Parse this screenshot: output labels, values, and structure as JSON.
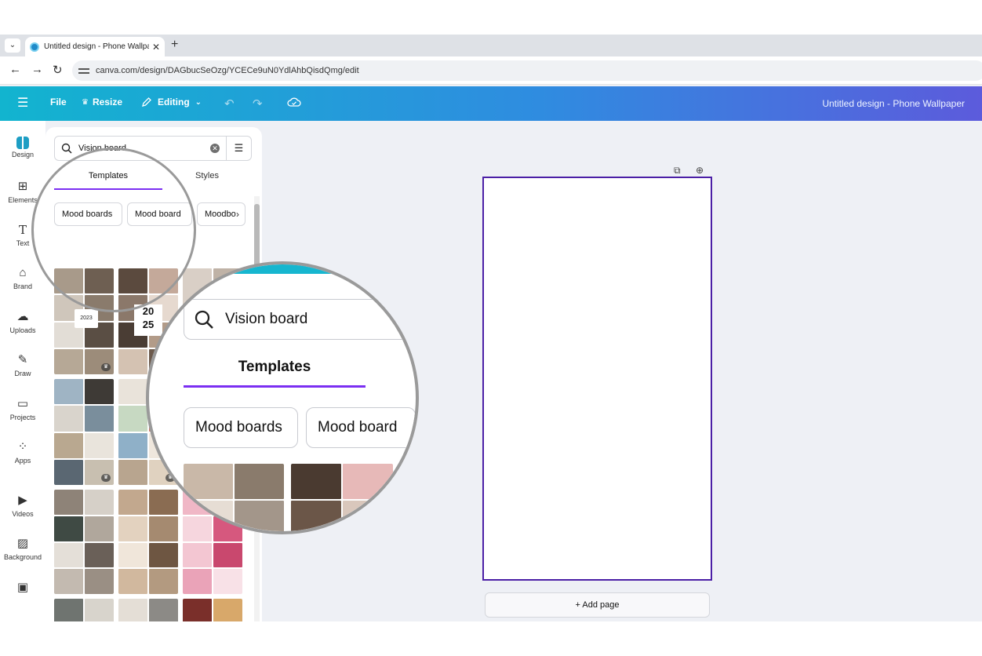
{
  "browser": {
    "tab_title": "Untitled design - Phone Wallpa",
    "url": "canva.com/design/DAGbucSeOzg/YCECe9uN0YdlAhbQisdQmg/edit",
    "new_tab": "+",
    "close": "✕"
  },
  "header": {
    "menu_icon": "☰",
    "file": "File",
    "resize": "Resize",
    "editing": "Editing",
    "doc_title": "Untitled design - Phone Wallpaper"
  },
  "rail": {
    "items": [
      {
        "label": "Design",
        "icon": "design-icon"
      },
      {
        "label": "Elements",
        "icon": "elements-icon"
      },
      {
        "label": "Text",
        "icon": "text-icon"
      },
      {
        "label": "Brand",
        "icon": "brand-icon"
      },
      {
        "label": "Uploads",
        "icon": "uploads-icon"
      },
      {
        "label": "Draw",
        "icon": "draw-icon"
      },
      {
        "label": "Projects",
        "icon": "projects-icon"
      },
      {
        "label": "Apps",
        "icon": "apps-icon"
      },
      {
        "label": "Videos",
        "icon": "videos-icon"
      },
      {
        "label": "Background",
        "icon": "background-icon"
      }
    ]
  },
  "panel": {
    "search_value": "Vision board",
    "tab_templates": "Templates",
    "tab_styles": "Styles",
    "chips": [
      "Mood boards",
      "Mood board",
      "Moodbo"
    ],
    "thumb_text": {
      "t1": "2023",
      "t2": "20\n25",
      "t10": "2025"
    }
  },
  "magnifier": {
    "search_value": "Vision board",
    "tab_templates": "Templates",
    "chips": [
      "Mood boards",
      "Mood board"
    ]
  },
  "canvas": {
    "add_page": "+ Add page"
  },
  "colors": {
    "accent": "#7b2ff2",
    "page_border": "#4b1fa6",
    "header_start": "#12b4cf",
    "header_end": "#5c5bdc"
  }
}
